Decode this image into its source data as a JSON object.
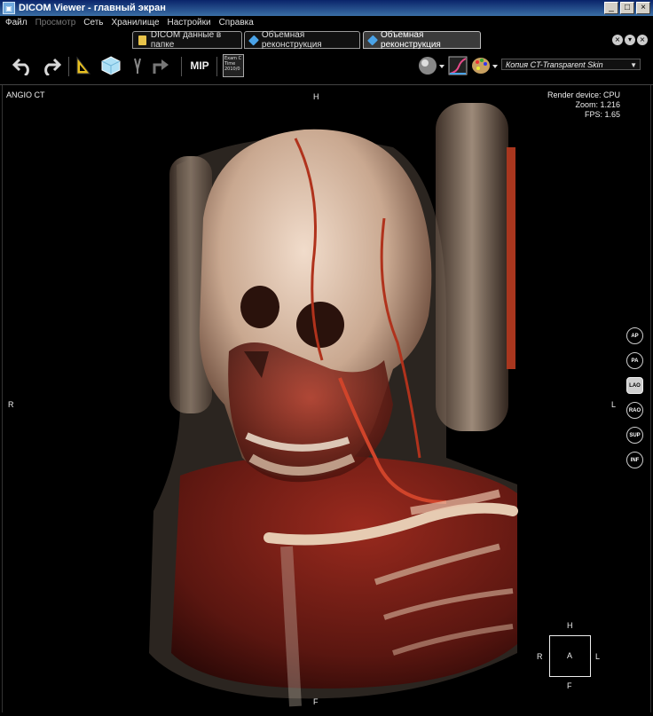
{
  "window": {
    "title": "DICOM Viewer - главный экран",
    "min": "_",
    "max": "□",
    "close": "×"
  },
  "menu": [
    {
      "label": "Файл",
      "disabled": false
    },
    {
      "label": "Просмотр",
      "disabled": true
    },
    {
      "label": "Сеть",
      "disabled": false
    },
    {
      "label": "Хранилище",
      "disabled": false
    },
    {
      "label": "Настройки",
      "disabled": false
    },
    {
      "label": "Справка",
      "disabled": false
    }
  ],
  "tabs": [
    {
      "label": "DICOM данные в папке",
      "icon": "folder-icon",
      "active": false
    },
    {
      "label": "Объемная реконструкция",
      "icon": "volume-icon",
      "active": false
    },
    {
      "label": "Объемная реконструкция",
      "icon": "volume-icon",
      "active": true
    }
  ],
  "toolbar": {
    "mip_label": "MIP",
    "exam_text": "Exam C\nTime\n2010/0",
    "preset_value": "Копия CT-Transparent Skin"
  },
  "viewport": {
    "series_label": "ANGIO CT",
    "render_device": "Render device: CPU",
    "zoom": "Zoom: 1.216",
    "fps": "FPS: 1.65",
    "orient_top": "H",
    "orient_bottom": "F",
    "orient_left": "R",
    "orient_right": "L"
  },
  "orientation_buttons": [
    {
      "label": "AP",
      "active": false
    },
    {
      "label": "PA",
      "active": false
    },
    {
      "label": "LAO",
      "active": true
    },
    {
      "label": "RAO",
      "active": false
    },
    {
      "label": "SUP",
      "active": false
    },
    {
      "label": "INF",
      "active": false
    }
  ],
  "orientation_cube": {
    "top": "H",
    "bottom": "F",
    "left": "R",
    "right": "L",
    "center": "A"
  },
  "colors": {
    "title_bar": "#0a246a",
    "background": "#000000",
    "tissue": "#7a1e14",
    "bone": "#e8d2bc"
  }
}
